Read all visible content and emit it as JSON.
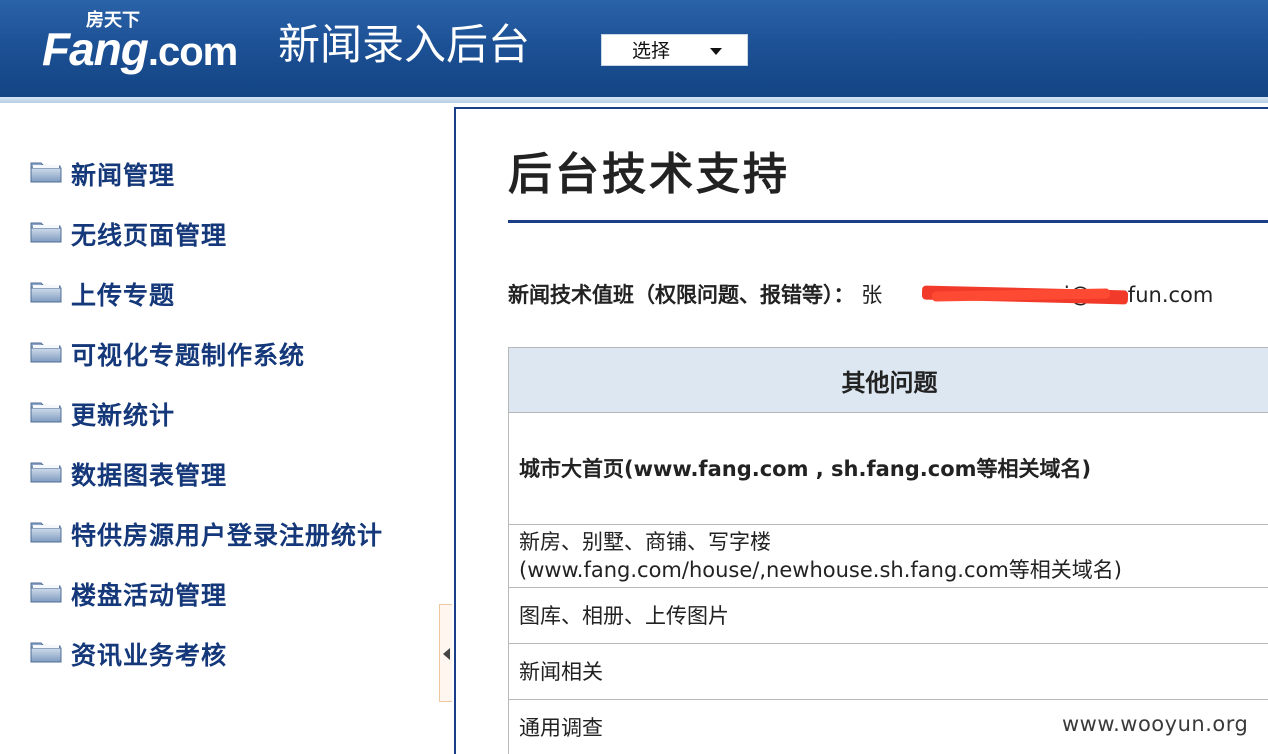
{
  "header": {
    "logo_text": "Fang",
    "logo_domain": ".com",
    "logo_cn": "房天下",
    "title": "新闻录入后台",
    "select": {
      "value": "选择"
    }
  },
  "sidebar": {
    "items": [
      {
        "label": "新闻管理"
      },
      {
        "label": "无线页面管理"
      },
      {
        "label": "上传专题"
      },
      {
        "label": "可视化专题制作系统"
      },
      {
        "label": "更新统计"
      },
      {
        "label": "数据图表管理"
      },
      {
        "label": "特供房源用户登录注册统计"
      },
      {
        "label": "楼盘活动管理"
      },
      {
        "label": "资讯业务考核"
      }
    ]
  },
  "main": {
    "title": "后台技术支持",
    "duty_label": "新闻技术值班（权限问题、报错等）：",
    "duty_contact_prefix": "张",
    "duty_contact_suffix": "i@soufun.com",
    "table": {
      "header": "其他问题",
      "rows": [
        {
          "text": "城市大首页(www.fang.com , sh.fang.com等相关域名)"
        },
        {
          "line1": "新房、别墅、商铺、写字楼",
          "line2": "(www.fang.com/house/,newhouse.sh.fang.com等相关域名)"
        },
        {
          "text": "图库、相册、上传图片"
        },
        {
          "text": "新闻相关"
        },
        {
          "text": "通用调查"
        }
      ]
    }
  },
  "watermark": "www.wooyun.org",
  "colors": {
    "header_blue": "#1d5196",
    "sidebar_text": "#14387a",
    "table_header_bg": "#dde7f2",
    "redaction": "#f23a2a"
  },
  "icons": {
    "sidebar": "folder-icon",
    "collapse": "collapse-left-icon",
    "select": "chevron-down-icon"
  }
}
